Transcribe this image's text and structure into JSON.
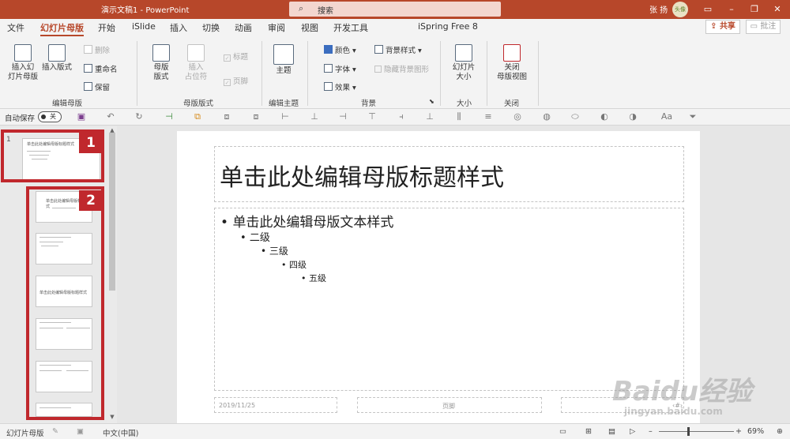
{
  "window": {
    "title": "演示文稿1  -  PowerPoint",
    "search_placeholder": "搜索",
    "user_name": "张 扬",
    "avatar_text": "头像",
    "minimize": "–",
    "restore": "❐",
    "close": "✕"
  },
  "tabs": [
    "文件",
    "幻灯片母版",
    "开始",
    "iSlide",
    "插入",
    "切换",
    "动画",
    "审阅",
    "视图",
    "开发工具",
    "iSpring Free 8"
  ],
  "active_tab": "幻灯片母版",
  "share_label": "共享",
  "share_icon": "share-icon",
  "comment_label": "批注",
  "comment_icon": "comment-icon",
  "ribbon": {
    "insert_master": "插入幻\n灯片母版",
    "insert_layout": "插入版式",
    "delete": "删除",
    "rename": "重命名",
    "preserve": "保留",
    "group_edit_master": "编辑母版",
    "master_layout": "母版\n版式",
    "insert_placeholder": "插入\n占位符",
    "title_check": "标题",
    "footer_check": "页脚",
    "group_master_layout": "母版版式",
    "themes": "主题",
    "group_edit_theme": "编辑主题",
    "colors": "颜色",
    "fonts": "字体",
    "effects": "效果",
    "bg_styles": "背景样式",
    "hide_bg": "隐藏背景图形",
    "group_background": "背景",
    "slide_size": "幻灯片\n大小",
    "group_size": "大小",
    "close_master": "关闭\n母版视图",
    "group_close": "关闭"
  },
  "qat": {
    "autosave": "自动保存",
    "toggle": "关",
    "font_size_hint": "Aa"
  },
  "thumbnails": {
    "slide_number": "1",
    "master_title": "单击此处编辑母版标题样式",
    "layout1_title": "单击此处编辑母版标题样式",
    "layout3_title": "单击此处编辑母版标题样式"
  },
  "badges": [
    "1",
    "2"
  ],
  "slide": {
    "title": "单击此处编辑母版标题样式",
    "body": [
      "单击此处编辑母版文本样式",
      "二级",
      "三级",
      "四级",
      "五级"
    ],
    "date": "2019/11/25",
    "footer": "页脚",
    "page_num": "‹#›"
  },
  "status": {
    "view": "幻灯片母版",
    "language": "中文(中国)",
    "zoom": "69%"
  },
  "watermark": {
    "brand": "Baidu经验",
    "url": "jingyan.baidu.com"
  }
}
